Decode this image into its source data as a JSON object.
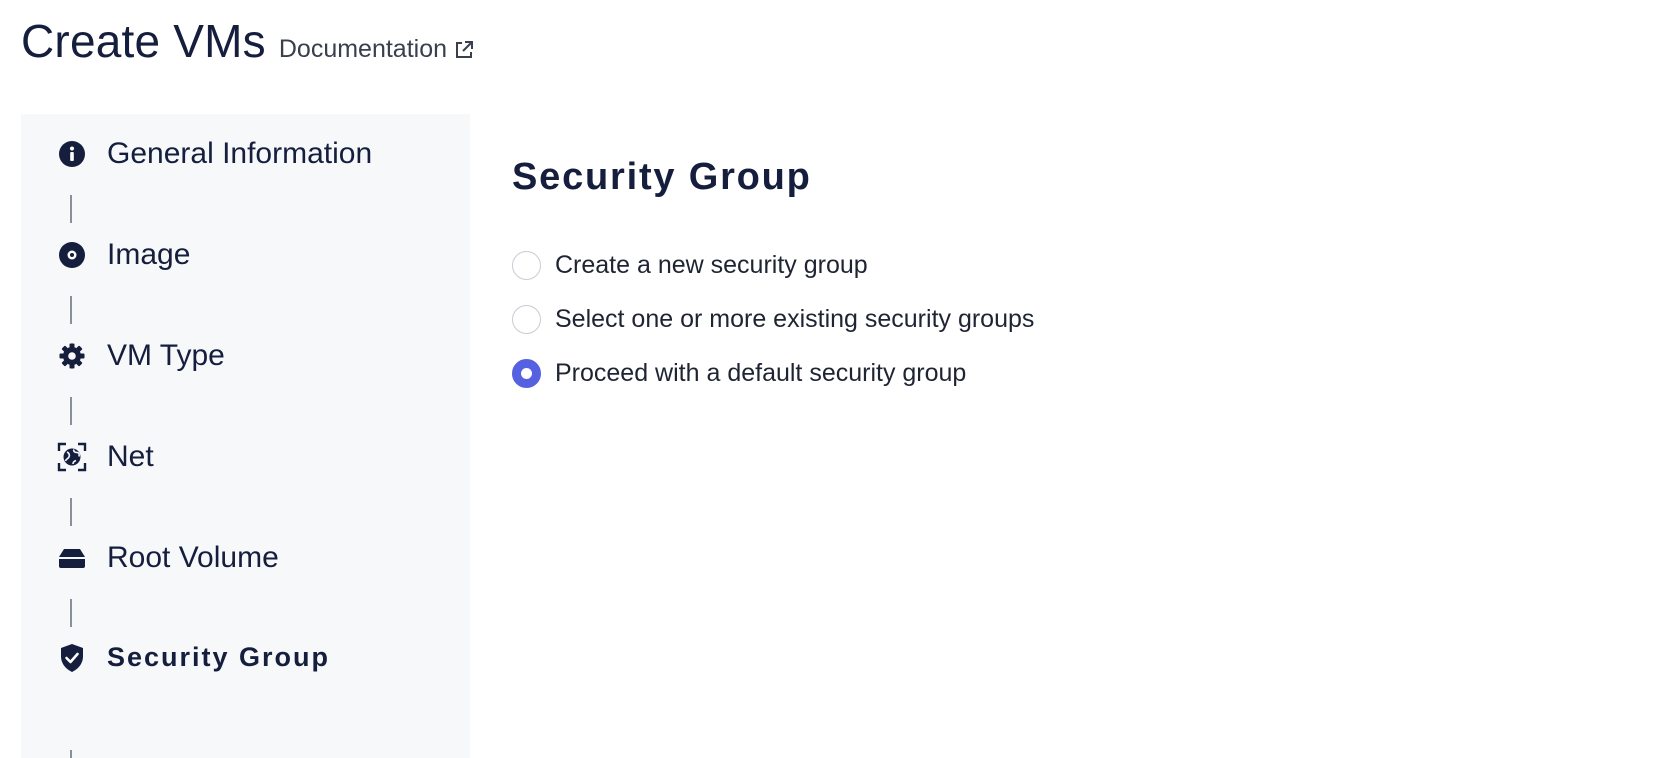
{
  "header": {
    "title": "Create VMs",
    "doc_link": "Documentation",
    "doc_icon": "external-link-icon"
  },
  "sidebar": {
    "steps": [
      {
        "label": "General Information",
        "icon": "info-icon",
        "active": false
      },
      {
        "label": "Image",
        "icon": "disc-icon",
        "active": false
      },
      {
        "label": "VM Type",
        "icon": "gear-icon",
        "active": false
      },
      {
        "label": "Net",
        "icon": "globe-scan-icon",
        "active": false
      },
      {
        "label": "Root Volume",
        "icon": "drive-icon",
        "active": false
      },
      {
        "label": "Security Group",
        "icon": "shield-check-icon",
        "active": true
      }
    ]
  },
  "main": {
    "section_title": "Security Group",
    "options": [
      {
        "label": "Create a new security group",
        "selected": false
      },
      {
        "label": "Select one or more existing security groups",
        "selected": false
      },
      {
        "label": "Proceed with a default security group",
        "selected": true
      }
    ]
  },
  "colors": {
    "primary_text": "#151e3d",
    "accent": "#5561e0",
    "sidebar_bg": "#f7f8fa"
  }
}
